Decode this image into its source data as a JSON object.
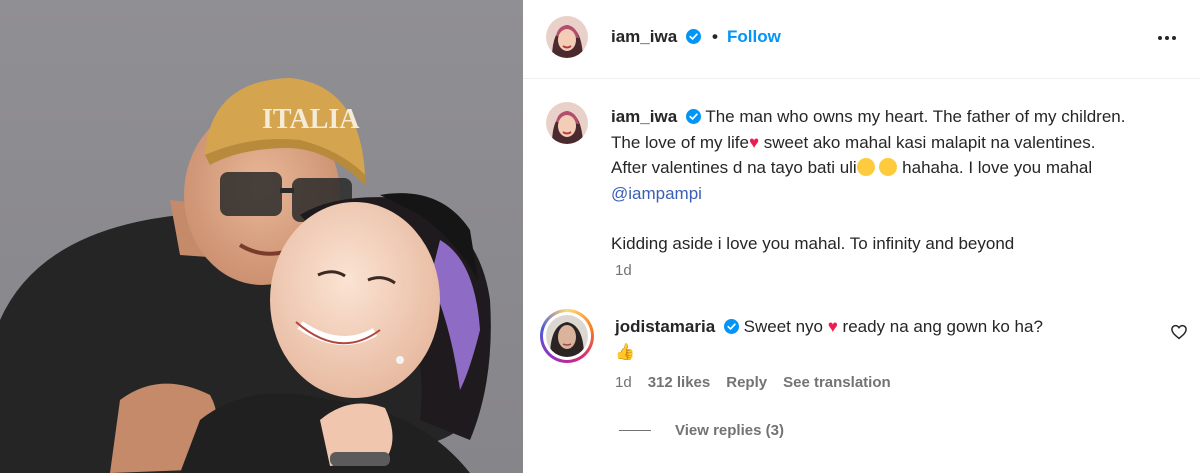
{
  "post": {
    "author": "iam_iwa",
    "follow_label": "Follow",
    "separator": "•",
    "more_icon": "more-horizontal-icon"
  },
  "caption": {
    "author": "iam_iwa",
    "line1_text": "The man who owns my heart. The father of my children. The love of my life",
    "line2_text": " sweet ako mahal kasi malapit na valentines. After valentines d na tayo bati uli",
    "line3_text": " hahaha. I love you mahal ",
    "mention": "@iampampi",
    "paragraph2": "Kidding aside i love you mahal. To infinity and beyond",
    "time": "1d",
    "emojis": [
      "red-heart",
      "zany-face",
      "rolling-laugh-face"
    ]
  },
  "comment": {
    "author": "jodistamaria",
    "text_before": "Sweet nyo ",
    "text_after": " ready na ang gown ko ha?",
    "time": "1d",
    "likes": "312 likes",
    "reply_label": "Reply",
    "translate_label": "See translation",
    "view_replies": "View replies (3)",
    "emojis": [
      "pink-heart",
      "thumbs-up"
    ]
  },
  "colors": {
    "follow_blue": "#0095f6",
    "mention_blue": "#3a5fb5",
    "secondary_text": "#737373",
    "verified_blue": "#0095f6"
  }
}
